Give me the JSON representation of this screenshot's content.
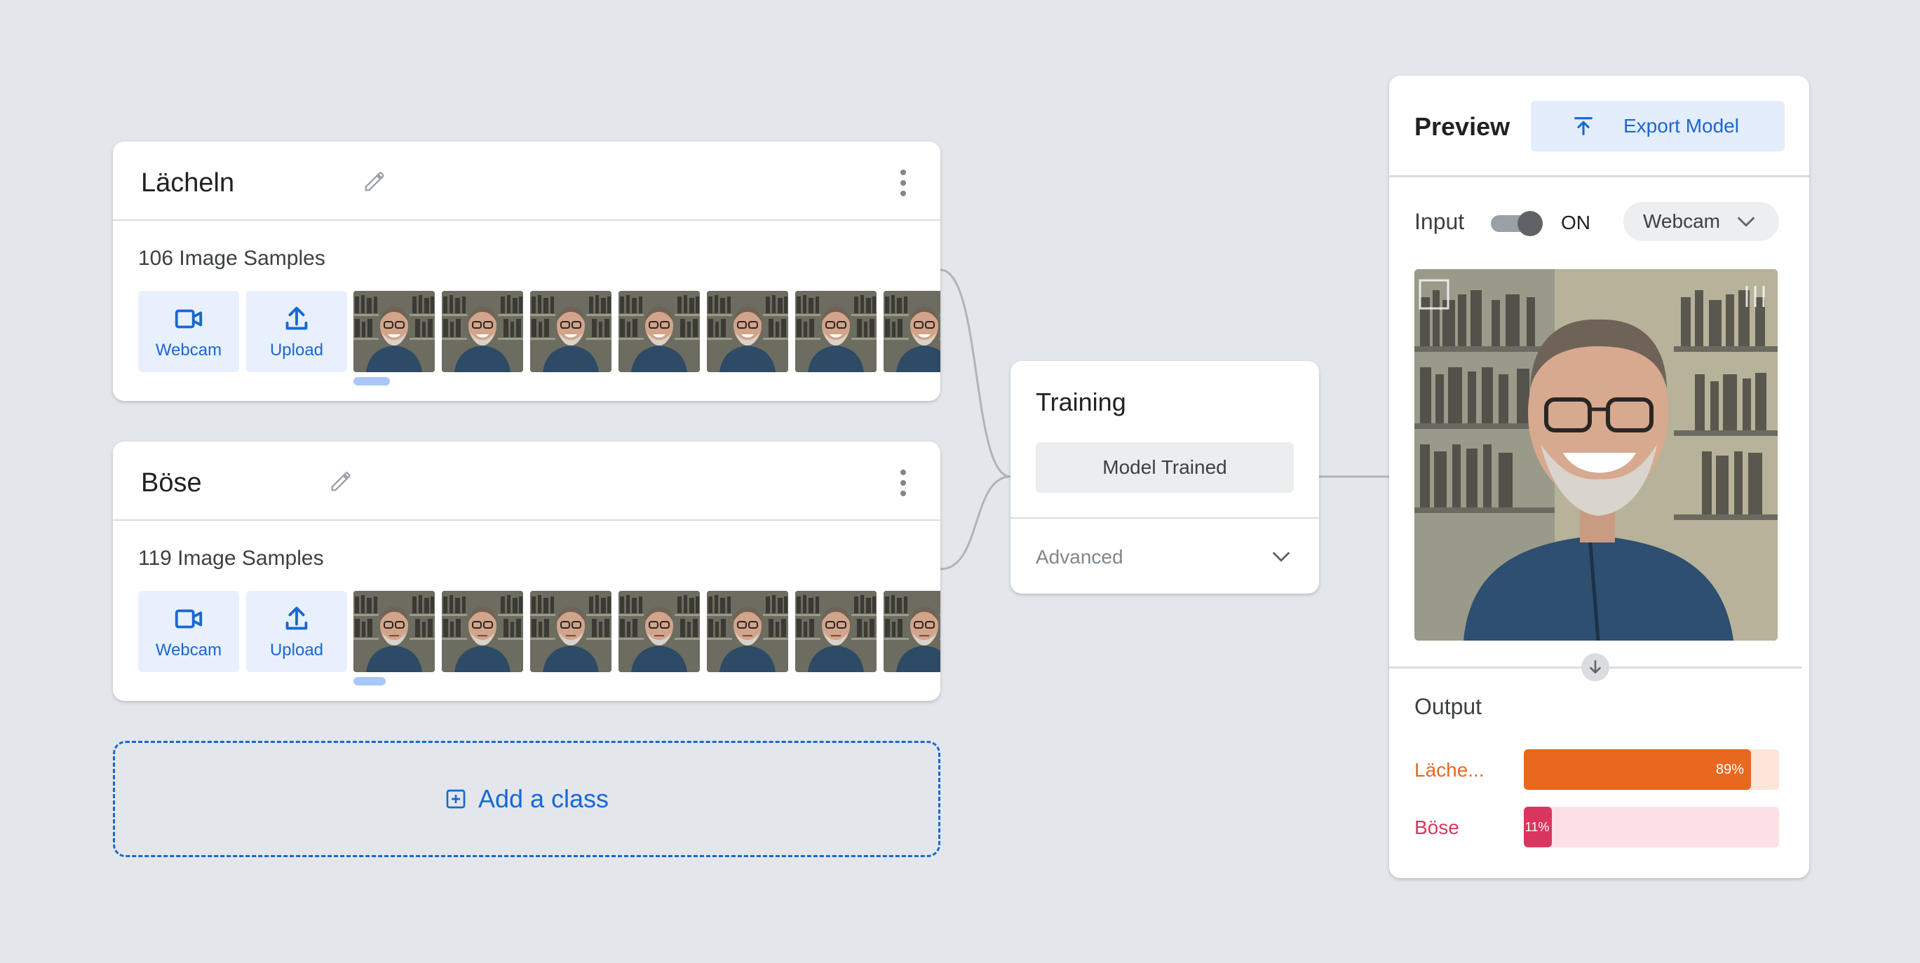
{
  "classes": [
    {
      "name": "Lächeln",
      "samples_label": "106 Image Samples",
      "webcam_label": "Webcam",
      "upload_label": "Upload"
    },
    {
      "name": "Böse",
      "samples_label": "119 Image Samples",
      "webcam_label": "Webcam",
      "upload_label": "Upload"
    }
  ],
  "add_class": {
    "label": "Add a class"
  },
  "training": {
    "title": "Training",
    "button_label": "Model Trained",
    "advanced_label": "Advanced"
  },
  "preview": {
    "title": "Preview",
    "export_label": "Export Model",
    "input_label": "Input",
    "toggle_state": "ON",
    "source_selected": "Webcam",
    "output_label": "Output",
    "outputs": [
      {
        "name": "Läche...",
        "percent_label": "89%",
        "value": 0.89,
        "color": "#e8681f",
        "track_color": "#fde5d9",
        "text_color": "#e8681f"
      },
      {
        "name": "Böse",
        "percent_label": "11%",
        "value": 0.11,
        "color": "#d9365f",
        "track_color": "#fde0e5",
        "text_color": "#d9365f"
      }
    ]
  },
  "colors": {
    "accent_blue": "#1967d2",
    "background": "#e3e7eb"
  }
}
